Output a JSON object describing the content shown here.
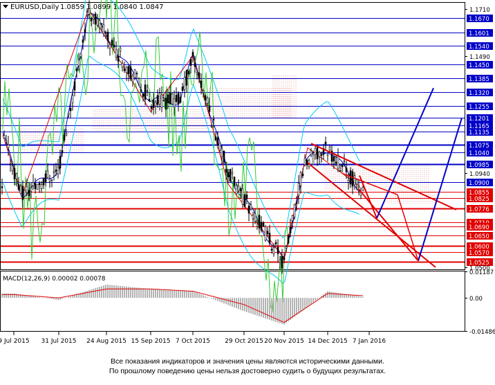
{
  "header": {
    "symbol": "EURUSD,Daily",
    "ohlc": "1.0859 1.0899 1.0840 1.0847"
  },
  "disclaimer": {
    "line1": "Все показания индикаторов и значения цены являются историческими данными.",
    "line2": "По прошлому поведению цены нельзя достоверно судить о будущих результатах."
  },
  "colors": {
    "candle": "#000000",
    "bollinger": "#00c8ff",
    "rsi_green": "#33cc33",
    "zigzag_red": "#e00000",
    "ma_blue": "#0000c8",
    "level_blue": "#0000c8",
    "level_red": "#e00000",
    "macd_hist": "#b4b4b4",
    "macd_signal": "#e00000",
    "channel_blue": "#0000c8",
    "channel_red": "#e00000",
    "ichimoku_cloud": "#e8a0a0"
  },
  "chart_data": [
    {
      "type": "candlestick",
      "title": "EURUSD,Daily",
      "ohlc_last": {
        "open": 1.0859,
        "high": 1.0899,
        "low": 1.084,
        "close": 1.0847
      },
      "ylim": [
        1.049,
        1.174
      ],
      "y_ticks": [
        "1.1710",
        "1.1490",
        "1.0940",
        "1.0500"
      ],
      "x_ticks": [
        "9 Jul 2015",
        "31 Jul 2015",
        "24 Aug 2015",
        "15 Sep 2015",
        "7 Oct 2015",
        "29 Oct 2015",
        "20 Nov 2015",
        "14 Dec 2015",
        "7 Jan 2016"
      ],
      "levels_blue": [
        {
          "label": "1.1670",
          "value": 1.167,
          "bold": false
        },
        {
          "label": "1.1601",
          "value": 1.1601,
          "bold": false
        },
        {
          "label": "1.1540",
          "value": 1.154,
          "bold": false
        },
        {
          "label": "1.1450",
          "value": 1.145,
          "bold": false
        },
        {
          "label": "1.1385",
          "value": 1.1385,
          "bold": false
        },
        {
          "label": "1.1320",
          "value": 1.132,
          "bold": false
        },
        {
          "label": "1.1255",
          "value": 1.1255,
          "bold": false
        },
        {
          "label": "1.1201",
          "value": 1.1201,
          "bold": false
        },
        {
          "label": "1.1165",
          "value": 1.1165,
          "bold": false
        },
        {
          "label": "1.1135",
          "value": 1.1135,
          "bold": false
        },
        {
          "label": "1.1075",
          "value": 1.1075,
          "bold": true
        },
        {
          "label": "1.1040",
          "value": 1.104,
          "bold": false
        },
        {
          "label": "1.0985",
          "value": 1.0985,
          "bold": true
        },
        {
          "label": "1.0900",
          "value": 1.09,
          "bold": false
        }
      ],
      "levels_red": [
        {
          "label": "1.0855",
          "value": 1.0855,
          "bold": false
        },
        {
          "label": "1.0825",
          "value": 1.0825,
          "bold": false
        },
        {
          "label": "1.0776",
          "value": 1.0776,
          "bold": true
        },
        {
          "label": "1.0710",
          "value": 1.071,
          "bold": false
        },
        {
          "label": "1.0690",
          "value": 1.069,
          "bold": false
        },
        {
          "label": "1.0650",
          "value": 1.065,
          "bold": false
        },
        {
          "label": "1.0600",
          "value": 1.06,
          "bold": true
        },
        {
          "label": "1.0570",
          "value": 1.057,
          "bold": false
        },
        {
          "label": "1.0525",
          "value": 1.0525,
          "bold": true
        }
      ],
      "series": [
        {
          "x": [
            "9 Jul 2015",
            "16 Jul 2015",
            "31 Jul 2015",
            "24 Aug 2015",
            "15 Sep 2015",
            "7 Oct 2015",
            "14 Oct 2015",
            "29 Oct 2015",
            "20 Nov 2015",
            "3 Dec 2015",
            "14 Dec 2015",
            "7 Jan 2016"
          ],
          "y": [
            1.112,
            1.084,
            1.096,
            1.171,
            1.128,
            1.128,
            1.149,
            1.094,
            1.052,
            1.099,
            1.106,
            1.0847
          ]
        }
      ]
    },
    {
      "type": "line",
      "title": "MACD(12,26,9) 0.00002 0.00078",
      "ylim": [
        -0.01486,
        0.01187
      ],
      "y_ticks": [
        "0.01187",
        "0.00",
        "-0.01486"
      ],
      "x": [
        "9 Jul 2015",
        "31 Jul 2015",
        "24 Aug 2015",
        "15 Sep 2015",
        "7 Oct 2015",
        "29 Oct 2015",
        "20 Nov 2015",
        "14 Dec 2015",
        "7 Jan 2016"
      ],
      "series": [
        {
          "values": [
            0.002,
            -0.001,
            0.006,
            0.004,
            0.003,
            -0.006,
            -0.012,
            0.003,
            0.0
          ]
        },
        {
          "values": [
            0.0015,
            0.0,
            0.004,
            0.004,
            0.003,
            -0.003,
            -0.011,
            0.002,
            0.0008
          ]
        }
      ]
    }
  ]
}
